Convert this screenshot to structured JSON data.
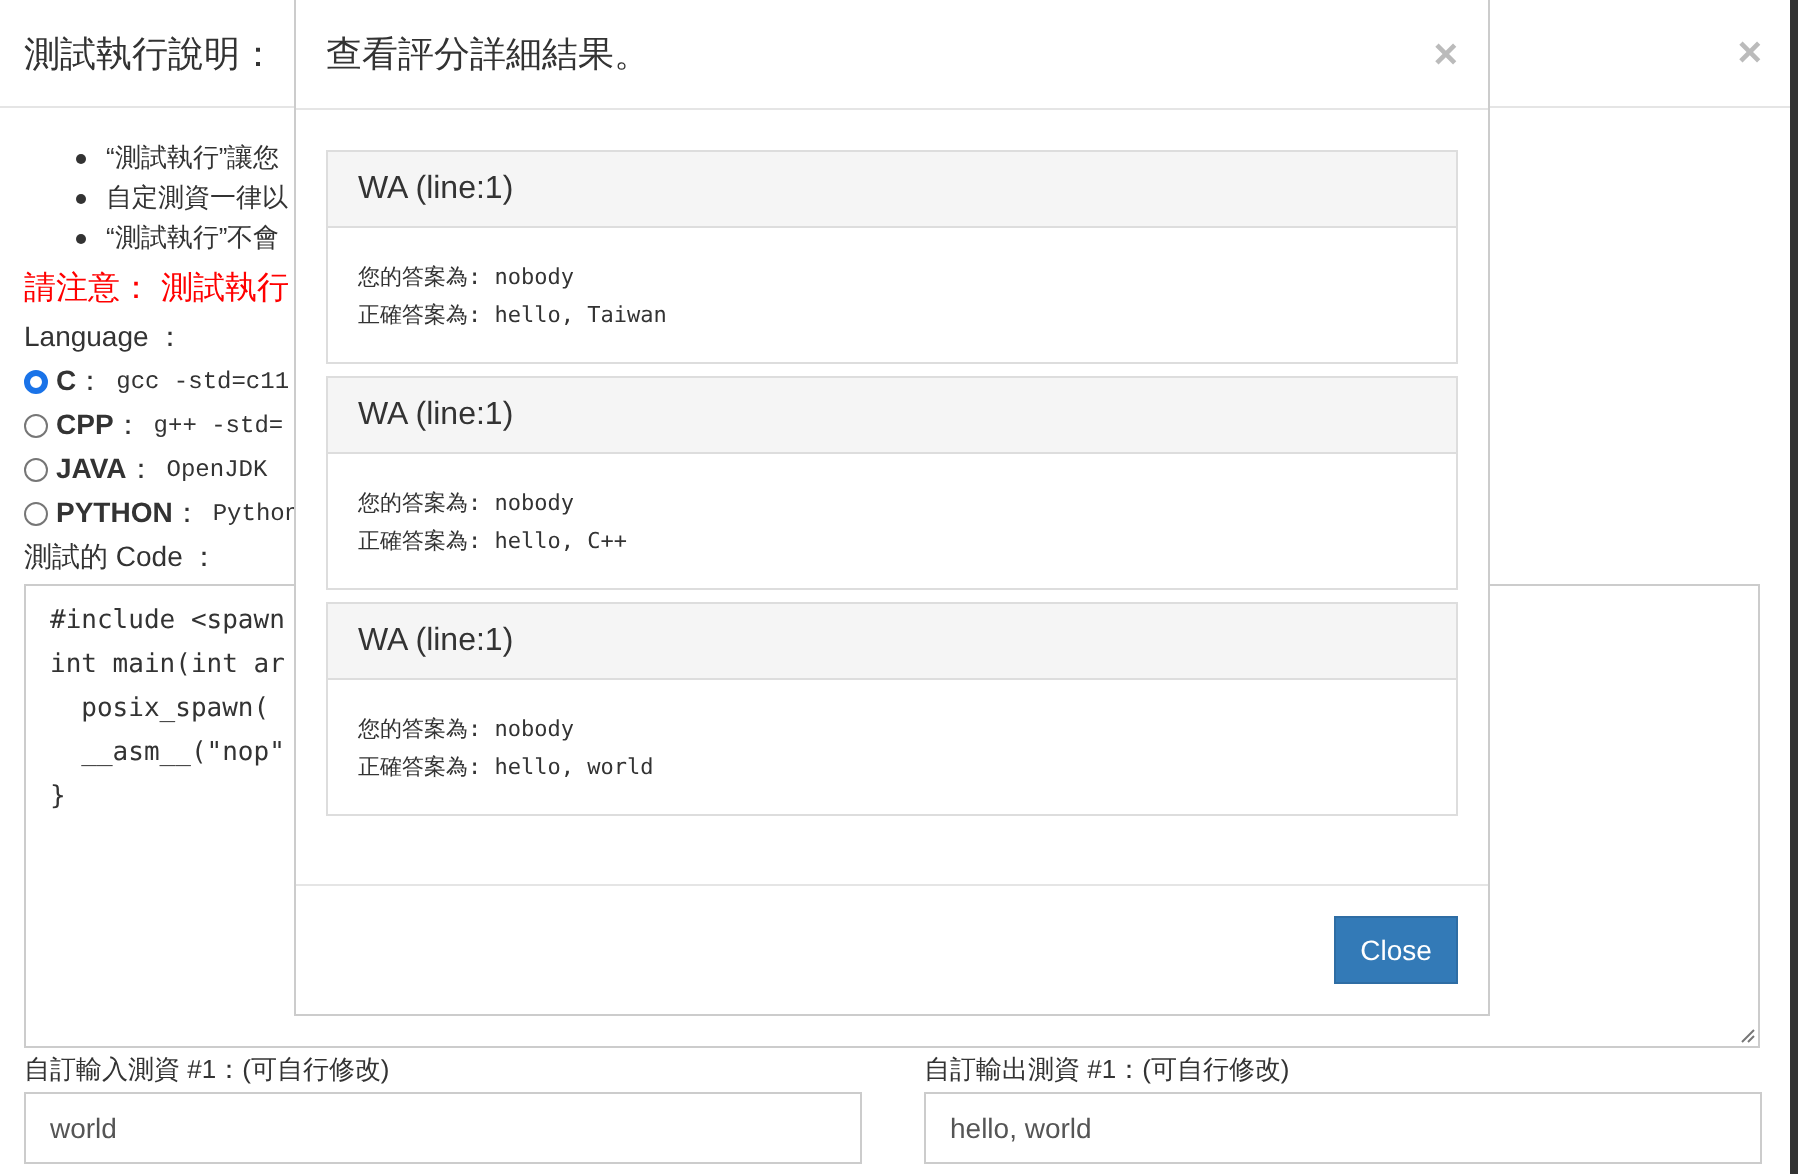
{
  "page": {
    "title": "測試執行說明：",
    "close_symbol": "×",
    "notes": [
      "“測試執行”讓您",
      "自定測資一律以",
      "“測試執行”不會"
    ],
    "warning": "請注意： 測試執行",
    "language_label": "Language ：",
    "languages": [
      {
        "label": "**C**：",
        "command": "gcc -std=c11",
        "selected": true
      },
      {
        "label": "**CPP**：",
        "command": "g++ -std=",
        "selected": false
      },
      {
        "label": "**JAVA**：",
        "command": "OpenJDK",
        "selected": false
      },
      {
        "label": "**PYTHON**：",
        "command": "Python",
        "selected": false
      }
    ],
    "code_label": "測試的 Code ：",
    "code_lines": [
      "#include <spawn",
      "int main(int ar",
      "  posix_spawn(",
      "  __asm__(\"nop\"",
      "}"
    ],
    "custom_input": {
      "label": "自訂輸入測資 #1：(可自行修改)",
      "value": "world"
    },
    "custom_output": {
      "label": "自訂輸出測資 #1：(可自行修改)",
      "value": "hello, world"
    }
  },
  "modal": {
    "title": "查看評分詳細結果。",
    "close_symbol": "×",
    "results": [
      {
        "verdict": "WA (line:1)",
        "answer_label": "您的答案為:",
        "answer": "nobody",
        "expected_label": "正確答案為:",
        "expected": "hello, Taiwan"
      },
      {
        "verdict": "WA (line:1)",
        "answer_label": "您的答案為:",
        "answer": "nobody",
        "expected_label": "正確答案為:",
        "expected": "hello, C++"
      },
      {
        "verdict": "WA (line:1)",
        "answer_label": "您的答案為:",
        "answer": "nobody",
        "expected_label": "正確答案為:",
        "expected": "hello, world"
      }
    ],
    "close_button": "Close"
  }
}
